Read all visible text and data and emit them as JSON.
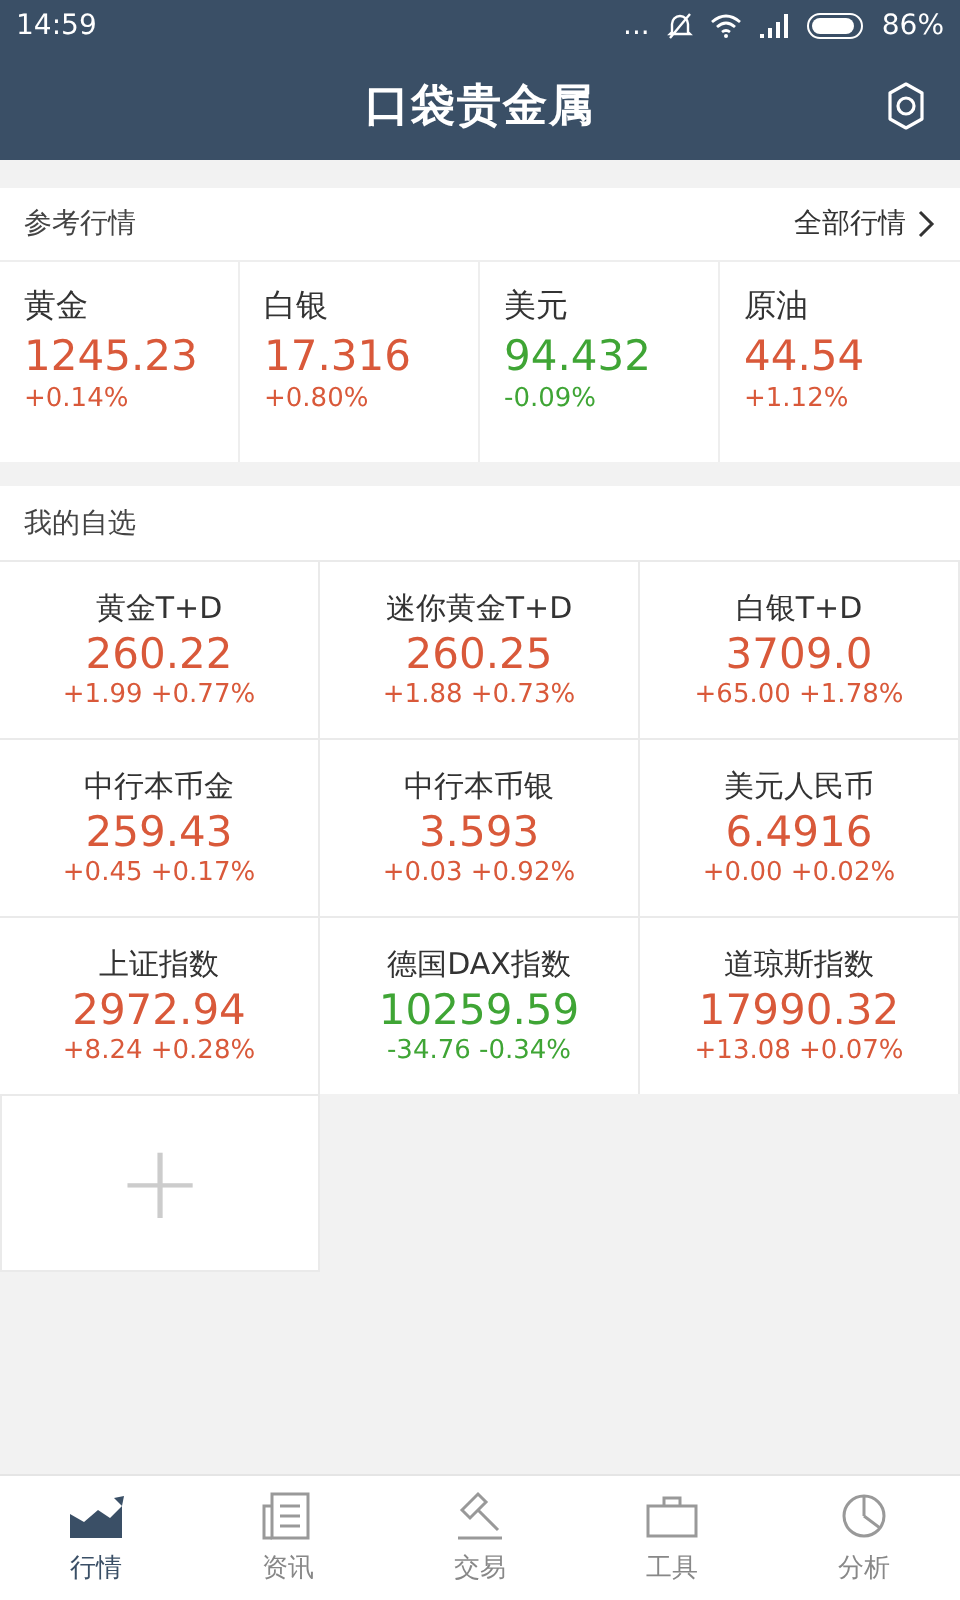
{
  "status_bar": {
    "time": "14:59",
    "dots": "...",
    "battery": "86%"
  },
  "header": {
    "title": "口袋贵金属"
  },
  "reference": {
    "title": "参考行情",
    "link": "全部行情",
    "items": [
      {
        "name": "黄金",
        "price": "1245.23",
        "change": "+0.14%",
        "kind": "up"
      },
      {
        "name": "白银",
        "price": "17.316",
        "change": "+0.80%",
        "kind": "up"
      },
      {
        "name": "美元",
        "price": "94.432",
        "change": "-0.09%",
        "kind": "down"
      },
      {
        "name": "原油",
        "price": "44.54",
        "change": "+1.12%",
        "kind": "up"
      }
    ]
  },
  "watchlist": {
    "title": "我的自选",
    "items": [
      {
        "name": "黄金T+D",
        "price": "260.22",
        "change": "+1.99",
        "percent": "+0.77%",
        "kind": "up"
      },
      {
        "name": "迷你黄金T+D",
        "price": "260.25",
        "change": "+1.88",
        "percent": "+0.73%",
        "kind": "up"
      },
      {
        "name": "白银T+D",
        "price": "3709.0",
        "change": "+65.00",
        "percent": "+1.78%",
        "kind": "up"
      },
      {
        "name": "中行本币金",
        "price": "259.43",
        "change": "+0.45",
        "percent": "+0.17%",
        "kind": "up"
      },
      {
        "name": "中行本币银",
        "price": "3.593",
        "change": "+0.03",
        "percent": "+0.92%",
        "kind": "up"
      },
      {
        "name": "美元人民币",
        "price": "6.4916",
        "change": "+0.00",
        "percent": "+0.02%",
        "kind": "up"
      },
      {
        "name": "上证指数",
        "price": "2972.94",
        "change": "+8.24",
        "percent": "+0.28%",
        "kind": "up"
      },
      {
        "name": "德国DAX指数",
        "price": "10259.59",
        "change": "-34.76",
        "percent": "-0.34%",
        "kind": "down"
      },
      {
        "name": "道琼斯指数",
        "price": "17990.32",
        "change": "+13.08",
        "percent": "+0.07%",
        "kind": "up"
      }
    ],
    "add": "+"
  },
  "nav": [
    {
      "label": "行情",
      "kind": "chart",
      "selected": true
    },
    {
      "label": "资讯",
      "kind": "news",
      "selected": false
    },
    {
      "label": "交易",
      "kind": "gavel",
      "selected": false
    },
    {
      "label": "工具",
      "kind": "tools",
      "selected": false
    },
    {
      "label": "分析",
      "kind": "analysis",
      "selected": false
    }
  ]
}
